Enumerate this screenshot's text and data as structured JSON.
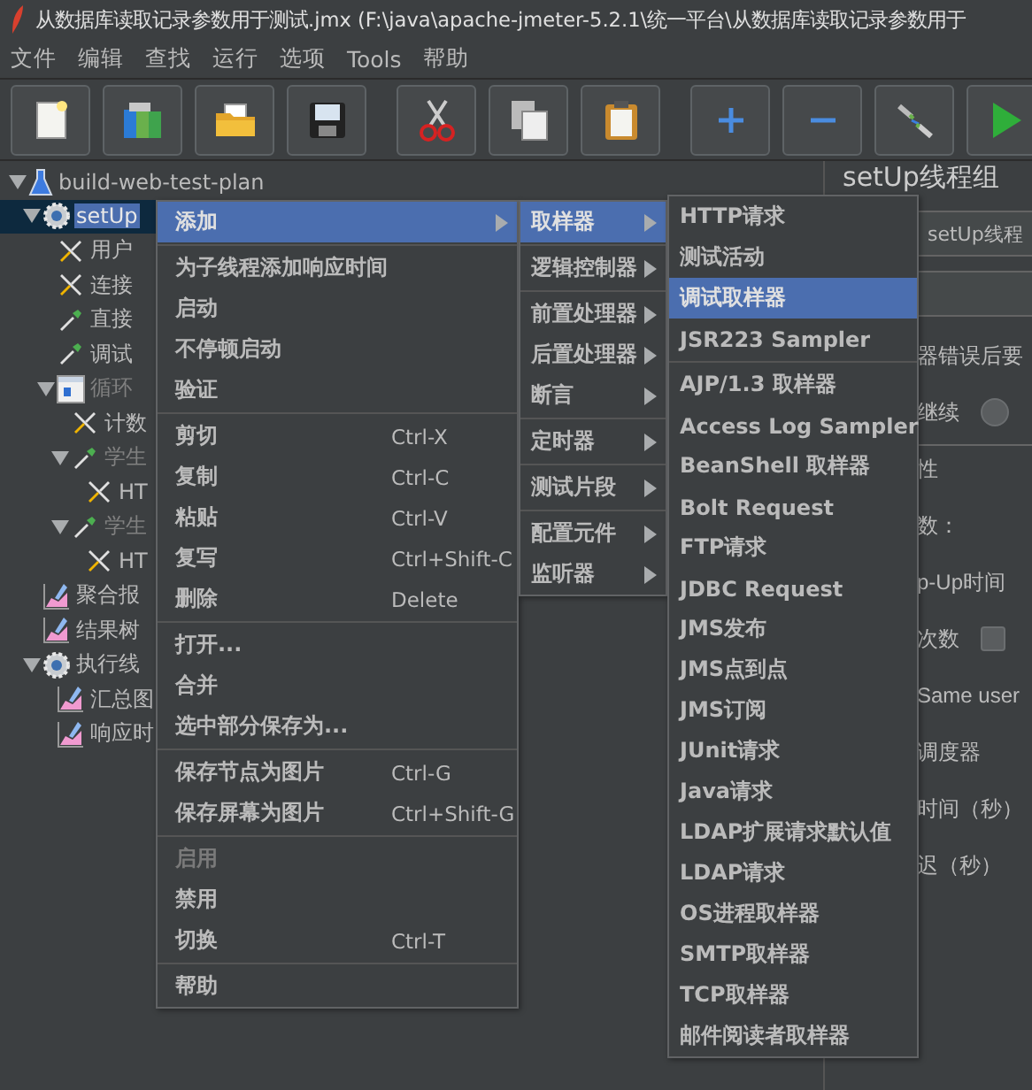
{
  "window": {
    "title": "从数据库读取记录参数用于测试.jmx (F:\\java\\apache-jmeter-5.2.1\\统一平台\\从数据库读取记录参数用于"
  },
  "menu_bar": [
    "文件",
    "编辑",
    "查找",
    "运行",
    "选项",
    "Tools",
    "帮助"
  ],
  "toolbar": [
    [
      {
        "kind": "new"
      },
      {
        "kind": "templates"
      },
      {
        "kind": "open"
      },
      {
        "kind": "save"
      }
    ],
    [
      {
        "kind": "cut"
      },
      {
        "kind": "copy"
      },
      {
        "kind": "paste"
      }
    ],
    [
      {
        "kind": "expand"
      },
      {
        "kind": "collapse"
      },
      {
        "kind": "toggle"
      },
      {
        "kind": "start"
      }
    ]
  ],
  "tree": [
    {
      "label": "build-web-test-plan",
      "kind": "flask",
      "expanded": true,
      "selected": false,
      "disabled": false,
      "children": [
        {
          "label": "setUp",
          "kind": "gear",
          "expanded": true,
          "selected": true,
          "disabled": false,
          "children": [
            {
              "label": "用户",
              "kind": "wrench",
              "selected": false,
              "disabled": false
            },
            {
              "label": "连接",
              "kind": "wrench",
              "selected": false,
              "disabled": false
            },
            {
              "label": "直接",
              "kind": "dropper",
              "selected": false,
              "disabled": false
            },
            {
              "label": "调试",
              "kind": "dropper",
              "selected": false,
              "disabled": false
            },
            {
              "label": "循环",
              "kind": "panel",
              "expanded": true,
              "selected": false,
              "disabled": true,
              "children": [
                {
                  "label": "计数",
                  "kind": "wrench",
                  "selected": false,
                  "disabled": false
                },
                {
                  "label": "学生",
                  "kind": "dropper",
                  "expanded": true,
                  "selected": false,
                  "disabled": true,
                  "children": [
                    {
                      "label": "HT",
                      "kind": "wrench",
                      "selected": false,
                      "disabled": false
                    }
                  ]
                },
                {
                  "label": "学生",
                  "kind": "dropper",
                  "expanded": true,
                  "selected": false,
                  "disabled": true,
                  "children": [
                    {
                      "label": "HT",
                      "kind": "wrench",
                      "selected": false,
                      "disabled": false
                    }
                  ]
                }
              ]
            }
          ]
        },
        {
          "label": "聚合报",
          "kind": "chart",
          "selected": false,
          "disabled": false
        },
        {
          "label": "结果树",
          "kind": "chart",
          "selected": false,
          "disabled": false
        },
        {
          "label": "执行线",
          "kind": "gear",
          "expanded": true,
          "selected": false,
          "disabled": false,
          "children": [
            {
              "label": "汇总图",
              "kind": "chart",
              "selected": false,
              "disabled": false
            },
            {
              "label": "响应时",
              "kind": "chart",
              "selected": false,
              "disabled": false
            }
          ]
        }
      ]
    }
  ],
  "settings_panel": {
    "title": "setUp线程组",
    "name_value": "setUp线程",
    "rows": [
      {
        "kind": "text",
        "label": "器错误后要"
      },
      {
        "kind": "radio",
        "label": "继续",
        "selected": false
      },
      {
        "kind": "group",
        "label": "性"
      },
      {
        "kind": "text",
        "label": "数："
      },
      {
        "kind": "text",
        "label": "p-Up时间"
      },
      {
        "kind": "checkbox",
        "label": "次数",
        "checked": false
      },
      {
        "kind": "text",
        "label": "Same user"
      },
      {
        "kind": "text",
        "label": "调度器"
      },
      {
        "kind": "text",
        "label": "时间（秒）"
      },
      {
        "kind": "text",
        "label": "迟（秒）"
      }
    ]
  },
  "context_menu": {
    "groups": [
      [
        {
          "label": "添加",
          "submenu": true,
          "selected": true,
          "disabled": false
        }
      ],
      [
        {
          "label": "为子线程添加响应时间",
          "submenu": false,
          "selected": false,
          "disabled": false
        },
        {
          "label": "启动",
          "submenu": false,
          "selected": false,
          "disabled": false
        },
        {
          "label": "不停顿启动",
          "submenu": false,
          "selected": false,
          "disabled": false
        },
        {
          "label": "验证",
          "submenu": false,
          "selected": false,
          "disabled": false
        }
      ],
      [
        {
          "label": "剪切",
          "shortcut": "Ctrl-X",
          "submenu": false,
          "selected": false,
          "disabled": false
        },
        {
          "label": "复制",
          "shortcut": "Ctrl-C",
          "submenu": false,
          "selected": false,
          "disabled": false
        },
        {
          "label": "粘贴",
          "shortcut": "Ctrl-V",
          "submenu": false,
          "selected": false,
          "disabled": false
        },
        {
          "label": "复写",
          "shortcut": "Ctrl+Shift-C",
          "submenu": false,
          "selected": false,
          "disabled": false
        },
        {
          "label": "删除",
          "shortcut": "Delete",
          "submenu": false,
          "selected": false,
          "disabled": false
        }
      ],
      [
        {
          "label": "打开...",
          "submenu": false,
          "selected": false,
          "disabled": false
        },
        {
          "label": "合并",
          "submenu": false,
          "selected": false,
          "disabled": false
        },
        {
          "label": "选中部分保存为...",
          "submenu": false,
          "selected": false,
          "disabled": false
        }
      ],
      [
        {
          "label": "保存节点为图片",
          "shortcut": "Ctrl-G",
          "submenu": false,
          "selected": false,
          "disabled": false
        },
        {
          "label": "保存屏幕为图片",
          "shortcut": "Ctrl+Shift-G",
          "submenu": false,
          "selected": false,
          "disabled": false
        }
      ],
      [
        {
          "label": "启用",
          "submenu": false,
          "selected": false,
          "disabled": true
        },
        {
          "label": "禁用",
          "submenu": false,
          "selected": false,
          "disabled": false
        },
        {
          "label": "切换",
          "shortcut": "Ctrl-T",
          "submenu": false,
          "selected": false,
          "disabled": false
        }
      ],
      [
        {
          "label": "帮助",
          "submenu": false,
          "selected": false,
          "disabled": false
        }
      ]
    ]
  },
  "add_submenu": {
    "groups": [
      [
        {
          "label": "取样器",
          "selected": true
        }
      ],
      [
        {
          "label": "逻辑控制器",
          "selected": false
        }
      ],
      [
        {
          "label": "前置处理器",
          "selected": false
        },
        {
          "label": "后置处理器",
          "selected": false
        },
        {
          "label": "断言",
          "selected": false
        }
      ],
      [
        {
          "label": "定时器",
          "selected": false
        }
      ],
      [
        {
          "label": "测试片段",
          "selected": false
        }
      ],
      [
        {
          "label": "配置元件",
          "selected": false
        },
        {
          "label": "监听器",
          "selected": false
        }
      ]
    ]
  },
  "sampler_submenu": {
    "groups": [
      [
        {
          "label": "HTTP请求",
          "selected": false
        },
        {
          "label": "测试活动",
          "selected": false
        },
        {
          "label": "调试取样器",
          "selected": true
        },
        {
          "label": "JSR223 Sampler",
          "selected": false
        }
      ],
      [
        {
          "label": "AJP/1.3 取样器",
          "selected": false
        },
        {
          "label": "Access Log Sampler",
          "selected": false
        },
        {
          "label": "BeanShell 取样器",
          "selected": false
        },
        {
          "label": "Bolt Request",
          "selected": false
        },
        {
          "label": "FTP请求",
          "selected": false
        },
        {
          "label": "JDBC Request",
          "selected": false
        },
        {
          "label": "JMS发布",
          "selected": false
        },
        {
          "label": "JMS点到点",
          "selected": false
        },
        {
          "label": "JMS订阅",
          "selected": false
        },
        {
          "label": "JUnit请求",
          "selected": false
        },
        {
          "label": "Java请求",
          "selected": false
        },
        {
          "label": "LDAP扩展请求默认值",
          "selected": false
        },
        {
          "label": "LDAP请求",
          "selected": false
        },
        {
          "label": "OS进程取样器",
          "selected": false
        },
        {
          "label": "SMTP取样器",
          "selected": false
        },
        {
          "label": "TCP取样器",
          "selected": false
        },
        {
          "label": "邮件阅读者取样器",
          "selected": false
        }
      ]
    ]
  }
}
